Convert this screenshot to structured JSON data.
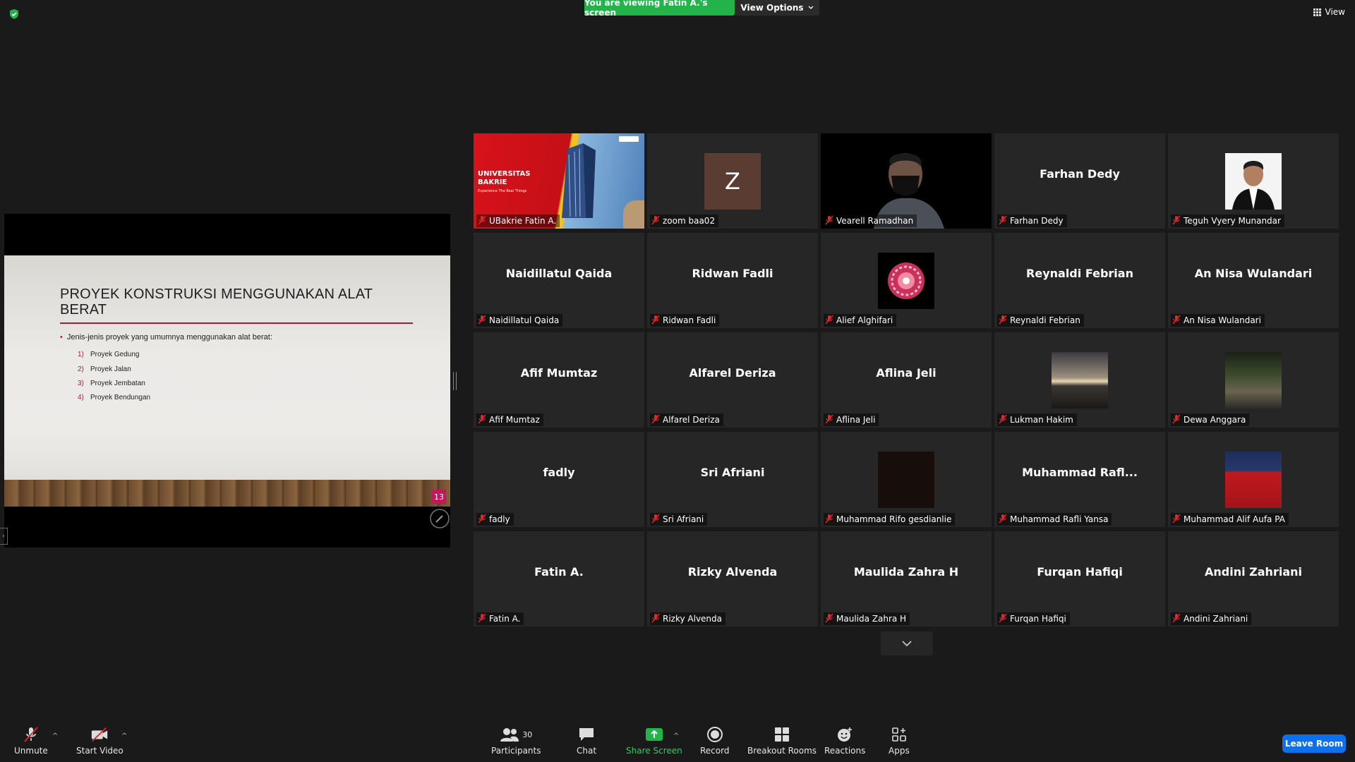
{
  "banner": {
    "viewing_text": "You are viewing Fatin A.'s screen",
    "view_options_label": "View Options",
    "view_label": "View"
  },
  "slide": {
    "title": "PROYEK KONSTRUKSI MENGGUNAKAN ALAT BERAT",
    "bullet": "Jenis-jenis proyek yang umumnya menggunakan alat berat:",
    "items": [
      {
        "num": "1)",
        "text": "Proyek Gedung"
      },
      {
        "num": "2)",
        "text": "Proyek Jalan"
      },
      {
        "num": "3)",
        "text": "Proyek Jembatan"
      },
      {
        "num": "4)",
        "text": "Proyek Bendungan"
      }
    ],
    "page_number": "13"
  },
  "tiles": [
    {
      "big": "",
      "name": "UBakrie Fatin A.",
      "media": "ubakrie",
      "logo_text": "UNIVERSITAS BAKRIE",
      "tagline": "Experience The Real Things"
    },
    {
      "big": "",
      "name": "zoom baa02",
      "media": "letter",
      "letter": "Z"
    },
    {
      "big": "",
      "name": "Vearell Ramadhan",
      "media": "video"
    },
    {
      "big": "Farhan Dedy",
      "name": "Farhan Dedy",
      "media": "none"
    },
    {
      "big": "",
      "name": "Teguh Vyery Munandar",
      "media": "photo-formal"
    },
    {
      "big": "Naidillatul Qaida",
      "name": "Naidillatul Qaida",
      "media": "none"
    },
    {
      "big": "Ridwan Fadli",
      "name": "Ridwan Fadli",
      "media": "none"
    },
    {
      "big": "",
      "name": "Alief Alghifari",
      "media": "mandala"
    },
    {
      "big": "Reynaldi Febrian",
      "name": "Reynaldi Febrian",
      "media": "none"
    },
    {
      "big": "An Nisa Wulandari",
      "name": "An Nisa Wulandari",
      "media": "none"
    },
    {
      "big": "Afif Mumtaz",
      "name": "Afif Mumtaz",
      "media": "none"
    },
    {
      "big": "Alfarel Deriza",
      "name": "Alfarel Deriza",
      "media": "none"
    },
    {
      "big": "Aflina Jeli",
      "name": "Aflina Jeli",
      "media": "none"
    },
    {
      "big": "",
      "name": "Lukman Hakim",
      "media": "sunset"
    },
    {
      "big": "",
      "name": "Dewa Anggara",
      "media": "night-street"
    },
    {
      "big": "fadly",
      "name": "fadly",
      "media": "none"
    },
    {
      "big": "Sri Afriani",
      "name": "Sri Afriani",
      "media": "none"
    },
    {
      "big": "",
      "name": "Muhammad Rifo gesdianlie",
      "media": "dark"
    },
    {
      "big": "Muhammad  Rafl...",
      "name": "Muhammad Rafli Yansa",
      "media": "none"
    },
    {
      "big": "",
      "name": "Muhammad Alif Aufa PA",
      "media": "red-jersey"
    },
    {
      "big": "Fatin A.",
      "name": "Fatin A.",
      "media": "none"
    },
    {
      "big": "Rizky Alvenda",
      "name": "Rizky Alvenda",
      "media": "none"
    },
    {
      "big": "Maulida Zahra H",
      "name": "Maulida Zahra H",
      "media": "none"
    },
    {
      "big": "Furqan Hafiqi",
      "name": "Furqan Hafiqi",
      "media": "none"
    },
    {
      "big": "Andini Zahriani",
      "name": "Andini Zahriani",
      "media": "none"
    }
  ],
  "toolbar": {
    "unmute": "Unmute",
    "start_video": "Start Video",
    "participants": "Participants",
    "participants_count": "30",
    "chat": "Chat",
    "share_screen": "Share Screen",
    "record": "Record",
    "breakout_rooms": "Breakout Rooms",
    "reactions": "Reactions",
    "apps": "Apps",
    "leave_room": "Leave Room"
  },
  "colors": {
    "banner_green": "#24b24a",
    "leave_blue": "#0e71eb",
    "active_speaker": "#f0e04a",
    "muted_red": "#e02828",
    "slide_accent": "#b5163b"
  }
}
